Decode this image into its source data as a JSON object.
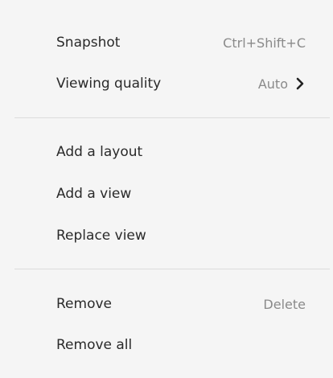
{
  "menu": {
    "snapshot": {
      "label": "Snapshot",
      "shortcut": "Ctrl+Shift+C"
    },
    "viewing_quality": {
      "label": "Viewing quality",
      "value": "Auto",
      "submenu_icon": "chevron-right-icon"
    },
    "add_layout": {
      "label": "Add a layout"
    },
    "add_view": {
      "label": "Add a view"
    },
    "replace_view": {
      "label": "Replace view"
    },
    "remove": {
      "label": "Remove",
      "shortcut": "Delete"
    },
    "remove_all": {
      "label": "Remove all"
    }
  }
}
